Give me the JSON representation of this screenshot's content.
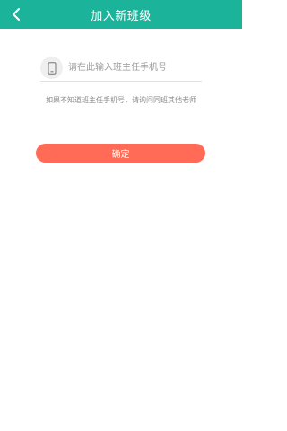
{
  "header": {
    "title": "加入新班级",
    "back_icon": "chevron-left-icon"
  },
  "form": {
    "phone_icon": "mobile-phone-icon",
    "phone_placeholder": "请在此输入班主任手机号",
    "phone_value": "",
    "hint": "如果不知道班主任手机号，请询问同班其他老师"
  },
  "actions": {
    "confirm_label": "确定"
  },
  "colors": {
    "header_bg": "#1bb39a",
    "primary_button": "#ff6b57"
  }
}
